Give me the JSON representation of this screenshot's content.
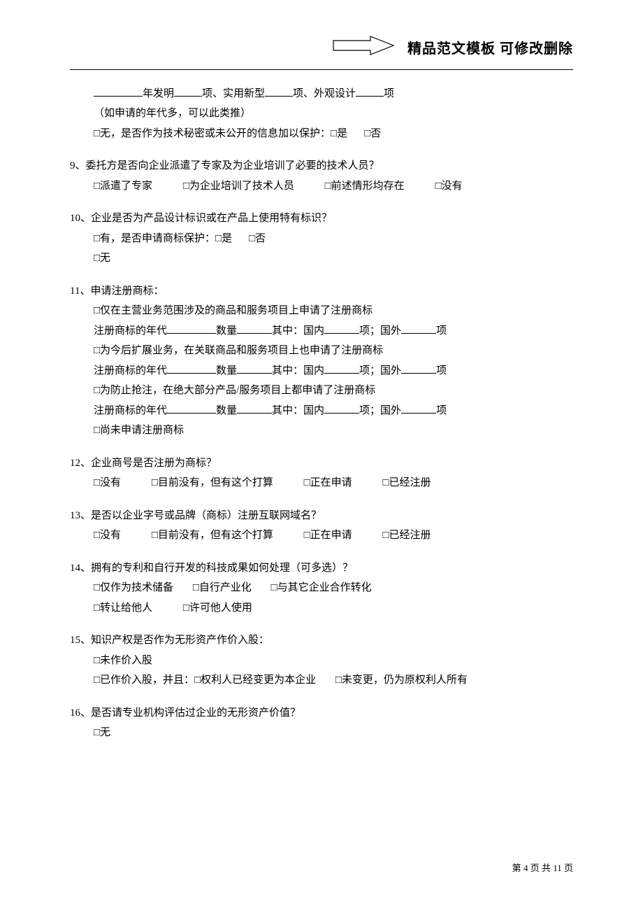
{
  "header": {
    "title": "精品范文模板  可修改删除"
  },
  "top": {
    "l1_a": "年发明",
    "l1_b": "项、实用新型",
    "l1_c": "项、外观设计",
    "l1_d": "项",
    "l2": "（如申请的年代多，可以此类推）",
    "l3_a": "□无，是否作为技术秘密或未公开的信息加以保护：□是",
    "l3_b": "□否"
  },
  "q9": {
    "title": "9、委托方是否向企业派遣了专家及为企业培训了必要的技术人员？",
    "o1": "□派遣了专家",
    "o2": "□为企业培训了技术人员",
    "o3": "□前述情形均存在",
    "o4": "□没有"
  },
  "q10": {
    "title": "10、企业是否为产品设计标识或在产品上使用特有标识？",
    "o1": "□有，是否申请商标保护：□是",
    "o1b": "□否",
    "o2": "□无"
  },
  "q11": {
    "title": "11、申请注册商标：",
    "a": "□仅在主营业务范围涉及的商品和服务项目上申请了注册商标",
    "b1": "注册商标的年代",
    "b2": "数量",
    "b3": "其中：国内",
    "b4": "项；国外",
    "b5": "项",
    "c": "□为今后扩展业务，在关联商品和服务项目上也申请了注册商标",
    "d": "□为防止抢注，在绝大部分产品/服务项目上都申请了注册商标",
    "e": "□尚未申请注册商标"
  },
  "q12": {
    "title": "12、企业商号是否注册为商标？",
    "o1": "□没有",
    "o2": "□目前没有，但有这个打算",
    "o3": "□正在申请",
    "o4": "□已经注册"
  },
  "q13": {
    "title": "13、是否以企业字号或品牌（商标）注册互联网域名？",
    "o1": "□没有",
    "o2": "□目前没有，但有这个打算",
    "o3": "□正在申请",
    "o4": "□已经注册"
  },
  "q14": {
    "title": "14、拥有的专利和自行开发的科技成果如何处理（可多选）？",
    "o1": "□仅作为技术储备",
    "o2": "□自行产业化",
    "o3": "□与其它企业合作转化",
    "o4": "□转让给他人",
    "o5": "□许可他人使用"
  },
  "q15": {
    "title": "15、知识产权是否作为无形资产作价入股：",
    "o1": "□未作价入股",
    "o2a": "□已作价入股，并且：□权利人已经变更为本企业",
    "o2b": "□未变更，仍为原权利人所有"
  },
  "q16": {
    "title": "16、是否请专业机构评估过企业的无形资产价值？",
    "o1": "□无"
  },
  "footer": {
    "p1": "第 ",
    "n1": "4",
    "p2": " 页 共 ",
    "n2": "11",
    "p3": " 页"
  }
}
